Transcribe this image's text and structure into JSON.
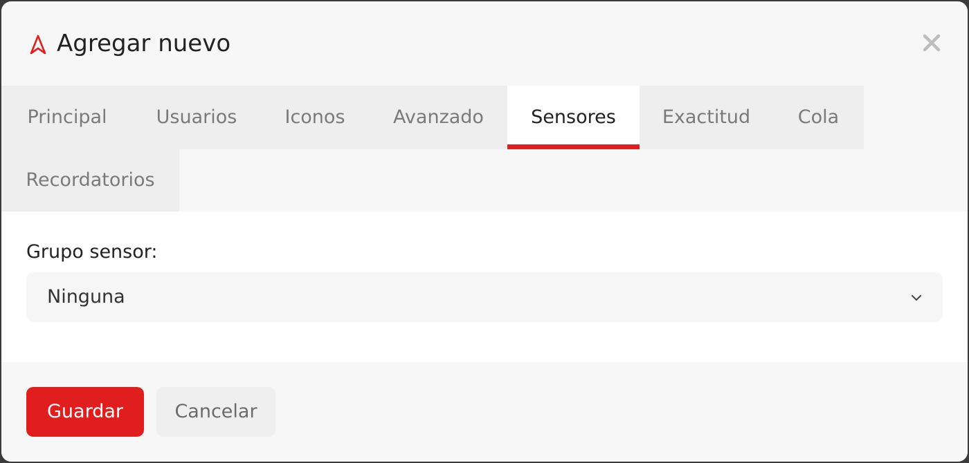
{
  "dialog": {
    "title": "Agregar nuevo",
    "logo_icon": "navigation-arrow-icon",
    "close_icon": "close-icon"
  },
  "tabs": [
    {
      "label": "Principal",
      "active": false
    },
    {
      "label": "Usuarios",
      "active": false
    },
    {
      "label": "Iconos",
      "active": false
    },
    {
      "label": "Avanzado",
      "active": false
    },
    {
      "label": "Sensores",
      "active": true
    },
    {
      "label": "Exactitud",
      "active": false
    },
    {
      "label": "Cola",
      "active": false
    },
    {
      "label": "Recordatorios",
      "active": false
    }
  ],
  "form": {
    "sensor_group_label": "Grupo sensor:",
    "sensor_group_value": "Ninguna",
    "chevron_icon": "chevron-down-icon"
  },
  "footer": {
    "save_label": "Guardar",
    "cancel_label": "Cancelar"
  },
  "colors": {
    "accent": "#e11e1e",
    "tab_background": "#eeeeee",
    "active_tab_background": "#ffffff",
    "modal_background": "#f7f7f7"
  }
}
